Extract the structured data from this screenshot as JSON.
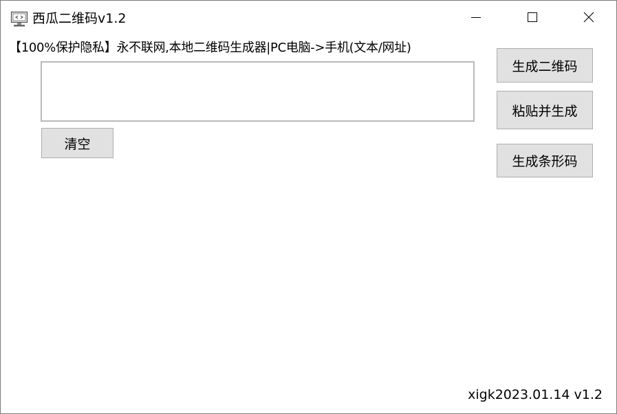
{
  "window": {
    "title": "西瓜二维码v1.2",
    "controls": {
      "minimize_icon": "minimize-icon",
      "maximize_icon": "maximize-icon",
      "close_icon": "close-icon"
    }
  },
  "main": {
    "header_label": "【100%保护隐私】永不联网,本地二维码生成器|PC电脑->手机(文本/网址)",
    "input": {
      "value": "",
      "placeholder": ""
    },
    "clear_button": "清空"
  },
  "actions": {
    "generate_qr": "生成二维码",
    "paste_generate": "粘贴并生成",
    "generate_barcode": "生成条形码"
  },
  "footer": {
    "version_text": "xigk2023.01.14 v1.2"
  },
  "colors": {
    "button_bg": "#e1e1e1",
    "button_border": "#adadad",
    "input_border": "#b9b9b9"
  }
}
